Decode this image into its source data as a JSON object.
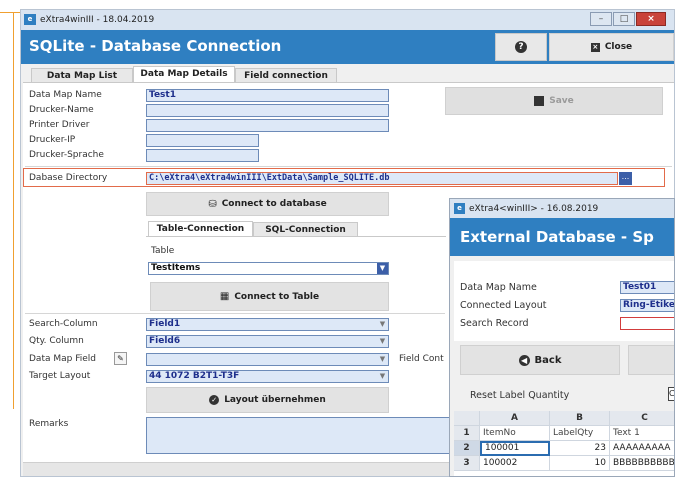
{
  "main_window": {
    "title": "eXtra4winIII  -  18.04.2019",
    "controls": {
      "minimize": "–",
      "maximize": "□",
      "close": "×"
    },
    "banner_title": "SQLite - Database Connection",
    "help_glyph": "?",
    "close_label": "Close",
    "tabs": [
      "Data Map List",
      "Data Map Details",
      "Field connection"
    ],
    "form": {
      "data_map_name": {
        "label": "Data Map Name",
        "value": "Test1"
      },
      "drucker_name": {
        "label": "Drucker-Name",
        "value": ""
      },
      "printer_driver": {
        "label": "Printer Driver",
        "value": ""
      },
      "drucker_ip": {
        "label": "Drucker-IP",
        "value": ""
      },
      "drucker_sprache": {
        "label": "Drucker-Sprache",
        "value": ""
      },
      "database_directory": {
        "label": "Dabase Directory",
        "value": "C:\\eXtra4\\eXtra4winIII\\ExtData\\Sample_SQLITE.db",
        "browse": "..."
      }
    },
    "save_label": "Save",
    "connect_database_label": "Connect to database",
    "sub_tabs": [
      "Table-Connection",
      "SQL-Connection"
    ],
    "table_label": "Table",
    "table_value": "TestItems",
    "connect_table_label": "Connect to Table",
    "search_column": {
      "label": "Search-Column",
      "value": "Field1"
    },
    "qty_column": {
      "label": "Qty. Column",
      "value": "Field6"
    },
    "data_map_field": {
      "label": "Data Map Field",
      "value": ""
    },
    "field_content_label": "Field Cont",
    "target_layout": {
      "label": "Target Layout",
      "value": "44 1072 B2T1-T3F"
    },
    "layout_button_label": "Layout übernehmen",
    "remarks_label": "Remarks"
  },
  "second_window": {
    "title": "eXtra4<winIII>  -  16.08.2019",
    "banner_title": "External Database - Sp",
    "form": {
      "data_map_name": {
        "label": "Data Map Name",
        "value": "Test01"
      },
      "connected_layout": {
        "label": "Connected Layout",
        "value": "Ring-Etike"
      },
      "search_record": {
        "label": "Search Record",
        "value": ""
      }
    },
    "back_label": "Back",
    "reset_label": "Reset Label Quantity",
    "grid": {
      "columns": [
        "A",
        "B",
        "C"
      ],
      "rows": [
        {
          "num": "1",
          "cells": [
            "ItemNo",
            "LabelQty",
            "Text 1"
          ]
        },
        {
          "num": "2",
          "cells": [
            "100001",
            "23",
            "AAAAAAAAA"
          ]
        },
        {
          "num": "3",
          "cells": [
            "100002",
            "10",
            "BBBBBBBBBB"
          ]
        }
      ]
    }
  },
  "colors": {
    "banner": "#2f7fc1",
    "field_bg": "#dde8f7",
    "field_text": "#1e2f8c",
    "highlight": "#e26b4a",
    "pointer": "#f0a030"
  }
}
